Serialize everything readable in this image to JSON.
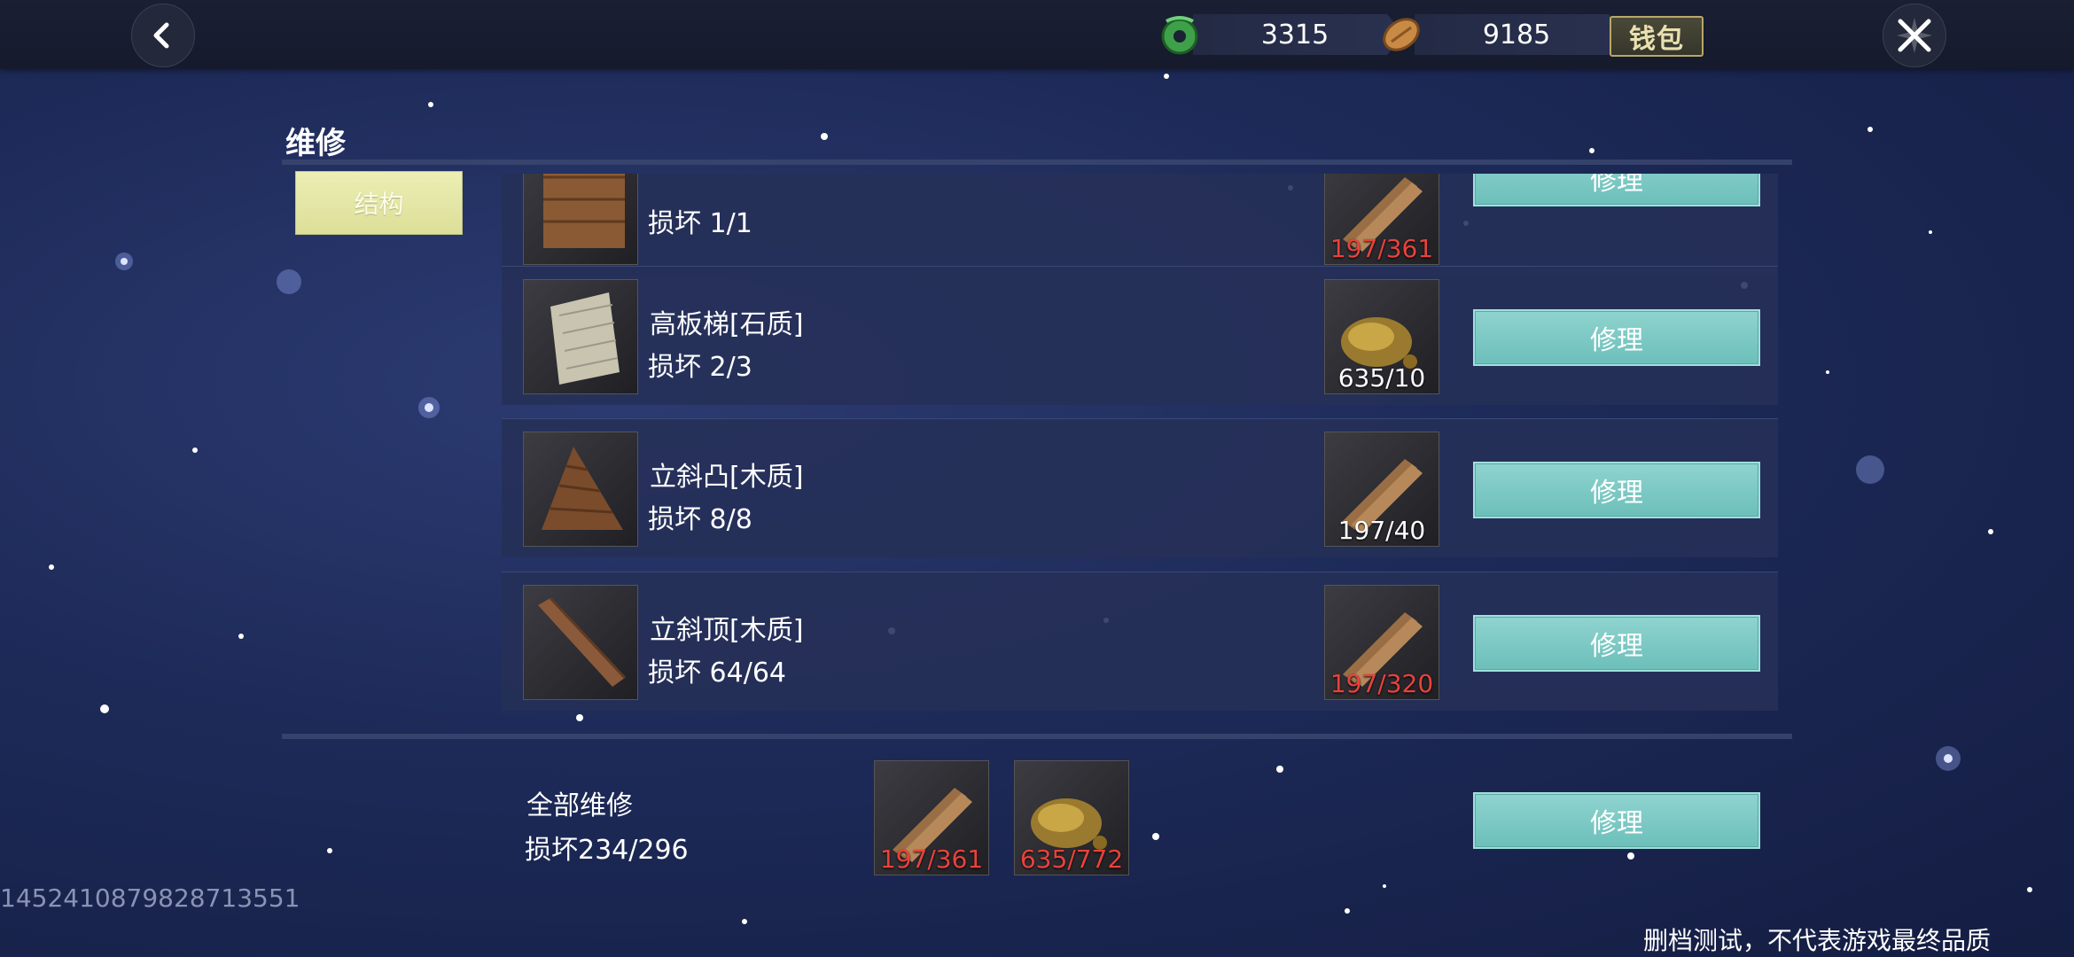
{
  "topbar": {
    "jade_value": "3315",
    "coin_value": "9185",
    "wallet_label": "钱包"
  },
  "panel": {
    "title": "维修",
    "tab_label": "结构"
  },
  "repair_items": [
    {
      "name": "",
      "damage": "损坏 1/1",
      "cost": "197/361",
      "cost_insufficient": true,
      "material": "wood-plank-icon",
      "button_label": "修理"
    },
    {
      "name": "高板梯[石质]",
      "damage": "损坏 2/3",
      "cost": "635/10",
      "cost_insufficient": false,
      "material": "stone-ore-icon",
      "button_label": "修理"
    },
    {
      "name": "立斜凸[木质]",
      "damage": "损坏 8/8",
      "cost": "197/40",
      "cost_insufficient": false,
      "material": "wood-plank-icon",
      "button_label": "修理"
    },
    {
      "name": "立斜顶[木质]",
      "damage": "损坏 64/64",
      "cost": "197/320",
      "cost_insufficient": true,
      "material": "wood-plank-icon",
      "button_label": "修理"
    }
  ],
  "repair_all": {
    "label": "全部维修",
    "damage": "损坏234/296",
    "wood_cost": "197/361",
    "stone_cost": "635/772",
    "button_label": "修理"
  },
  "watermark_id": "1452410879828713551",
  "disclaimer": "删档测试，不代表游戏最终品质",
  "colors": {
    "button": "#7cc9c5",
    "tab_active": "#e6e8a8",
    "insufficient": "#e8423c"
  }
}
